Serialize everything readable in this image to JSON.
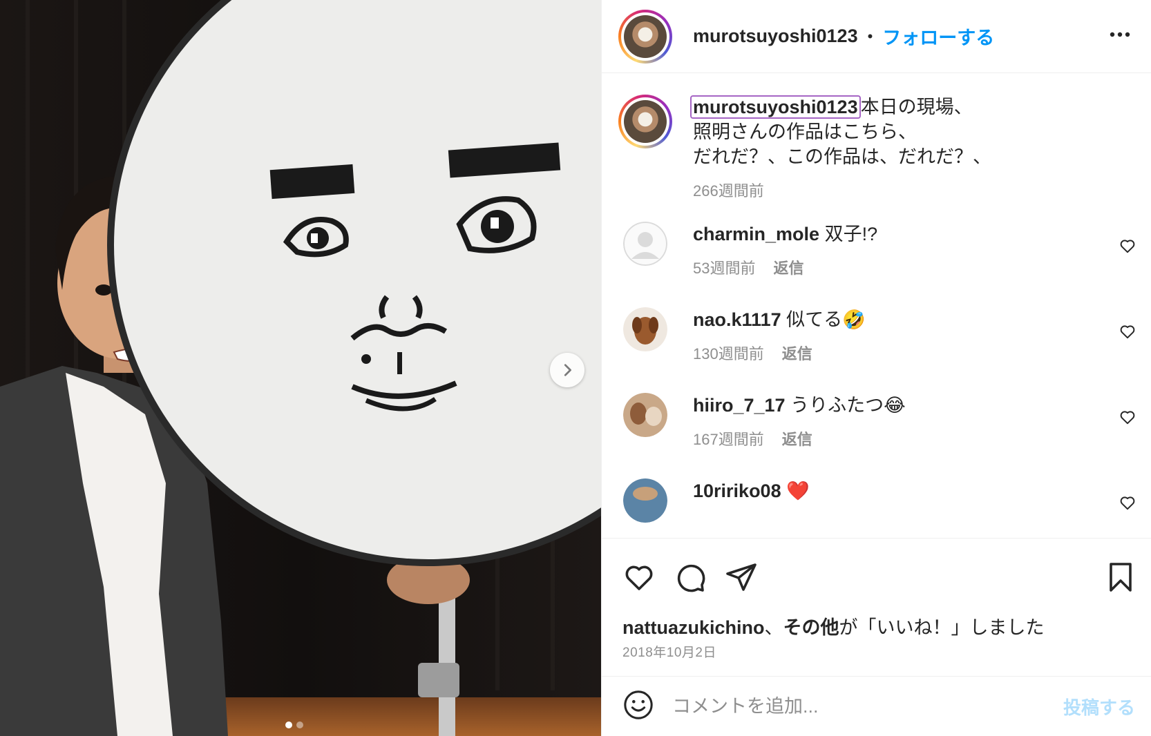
{
  "header": {
    "username": "murotsuyoshi0123",
    "separator": "•",
    "follow_label": "フォローする",
    "more_icon": "more-horizontal-icon"
  },
  "caption": {
    "username": "murotsuyoshi0123",
    "lines": [
      "本日の現場、",
      "照明さんの作品はこちら、",
      "だれだ？、この作品は、だれだ？、"
    ],
    "time": "266週間前"
  },
  "comments": [
    {
      "username": "charmin_mole",
      "text": "双子!?",
      "time": "53週間前",
      "reply": "返信"
    },
    {
      "username": "nao.k1117",
      "text": "似てる🤣",
      "time": "130週間前",
      "reply": "返信"
    },
    {
      "username": "hiiro_7_17",
      "text": "うりふたつ😂",
      "time": "167週間前",
      "reply": "返信"
    },
    {
      "username": "10ririko08",
      "text": "❤️",
      "time": "",
      "reply": ""
    }
  ],
  "actions": {
    "like_icon": "heart-icon",
    "comment_icon": "comment-icon",
    "share_icon": "paper-plane-icon",
    "save_icon": "bookmark-icon"
  },
  "likes": {
    "user": "nattuazukichino",
    "connector": "、",
    "others": "その他",
    "suffix": "が「いいね！」しました"
  },
  "date": "2018年10月2日",
  "composer": {
    "placeholder": "コメントを追加...",
    "post_label": "投稿する"
  },
  "carousel": {
    "current": 1,
    "total": 2
  },
  "colors": {
    "accent": "#0095f6",
    "post_disabled": "#b2dffc",
    "muted": "#8e8e8e",
    "text": "#262626"
  }
}
